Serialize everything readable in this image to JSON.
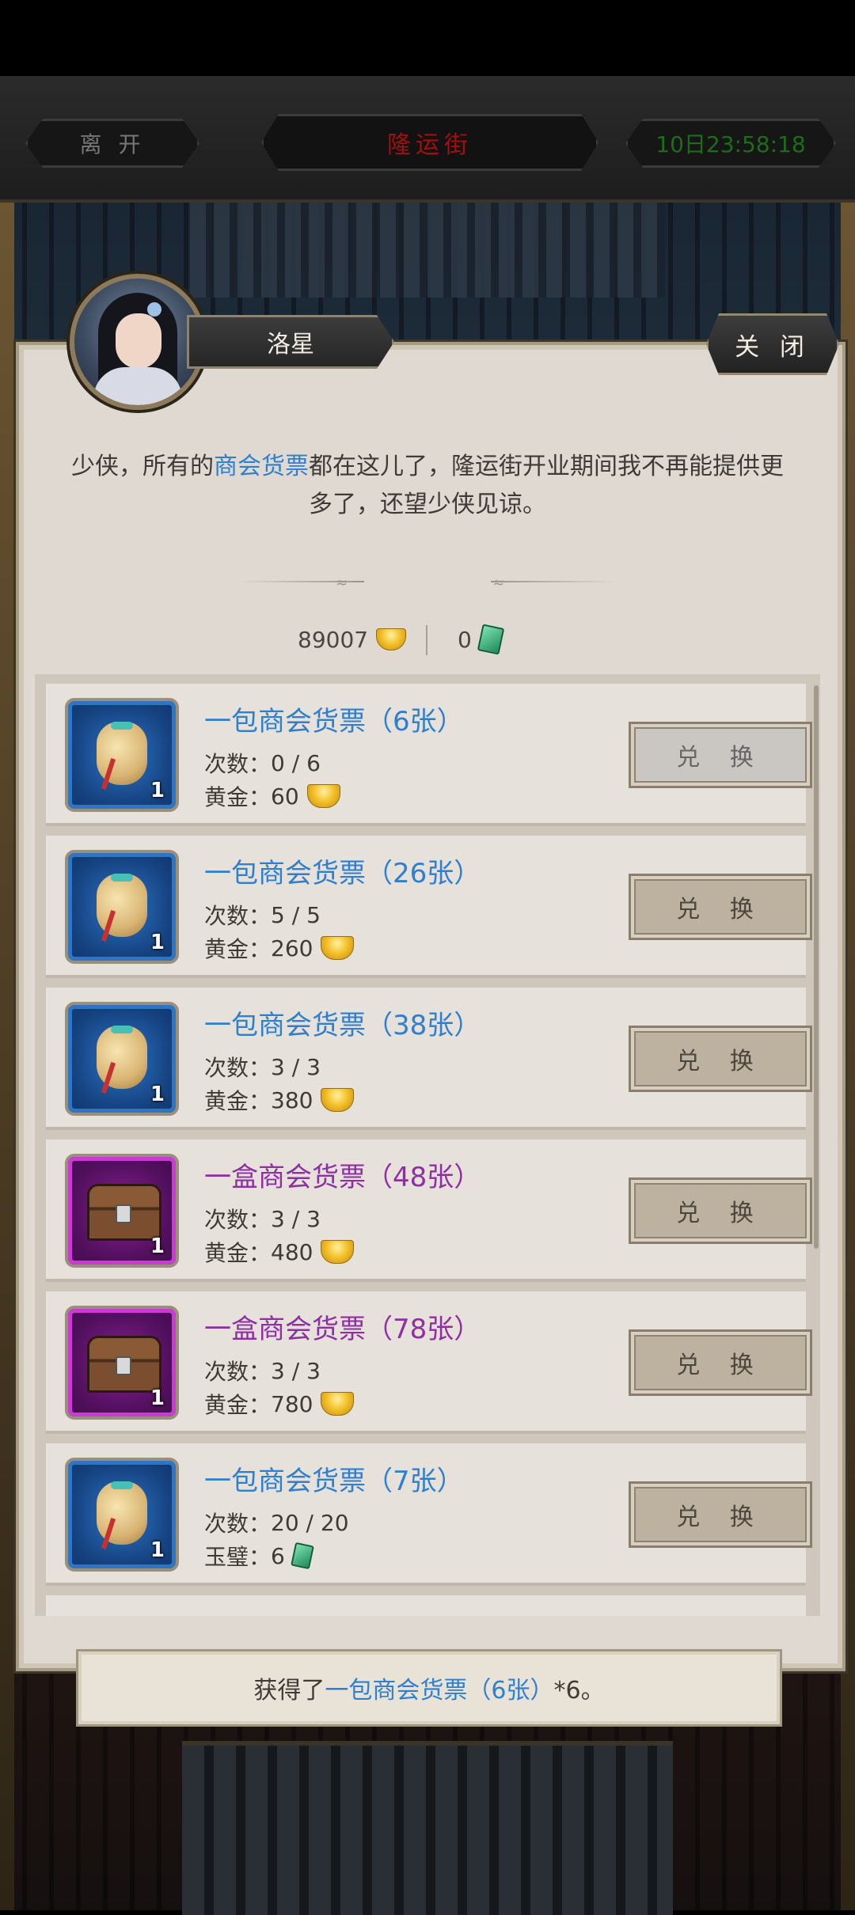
{
  "top": {
    "leave_label": "离 开",
    "title": "隆运街",
    "timer": "10日23:58:18"
  },
  "npc": {
    "name": "洛星",
    "close_label": "关 闭",
    "intro_before": "少侠，所有的",
    "intro_highlight": "商会货票",
    "intro_after": "都在这儿了，隆运街开业期间我不再能提供更多了，还望少侠见谅。"
  },
  "currency": {
    "gold": "89007",
    "jade": "0"
  },
  "items": [
    {
      "title": "一包商会货票（6张）",
      "count_label": "次数：",
      "count": "0 / 6",
      "cost_label": "黄金：",
      "cost": "60",
      "cost_icon": "gold-ingot",
      "qty": "1",
      "icon": "money-bag-icon",
      "rarity_color": "#2e76c4",
      "button": "兑 换",
      "enabled": false
    },
    {
      "title": "一包商会货票（26张）",
      "count_label": "次数：",
      "count": "5 / 5",
      "cost_label": "黄金：",
      "cost": "260",
      "cost_icon": "gold-ingot",
      "qty": "1",
      "icon": "money-bag-icon",
      "rarity_color": "#2e76c4",
      "button": "兑 换",
      "enabled": true
    },
    {
      "title": "一包商会货票（38张）",
      "count_label": "次数：",
      "count": "3 / 3",
      "cost_label": "黄金：",
      "cost": "380",
      "cost_icon": "gold-ingot",
      "qty": "1",
      "icon": "money-bag-icon",
      "rarity_color": "#2e76c4",
      "button": "兑 换",
      "enabled": true
    },
    {
      "title": "一盒商会货票（48张）",
      "count_label": "次数：",
      "count": "3 / 3",
      "cost_label": "黄金：",
      "cost": "480",
      "cost_icon": "gold-ingot",
      "qty": "1",
      "icon": "treasure-chest-icon",
      "rarity_color": "#c93bd3",
      "button": "兑 换",
      "enabled": true
    },
    {
      "title": "一盒商会货票（78张）",
      "count_label": "次数：",
      "count": "3 / 3",
      "cost_label": "黄金：",
      "cost": "780",
      "cost_icon": "gold-ingot",
      "qty": "1",
      "icon": "treasure-chest-icon",
      "rarity_color": "#c93bd3",
      "button": "兑 换",
      "enabled": true
    },
    {
      "title": "一包商会货票（7张）",
      "count_label": "次数：",
      "count": "20 / 20",
      "cost_label": "玉璧：",
      "cost": "6",
      "cost_icon": "jade",
      "qty": "1",
      "icon": "money-bag-icon",
      "rarity_color": "#2e76c4",
      "button": "兑 换",
      "enabled": true
    }
  ],
  "toast": {
    "before": "获得了",
    "highlight": "一包商会货票（6张）",
    "after": "*6。"
  }
}
